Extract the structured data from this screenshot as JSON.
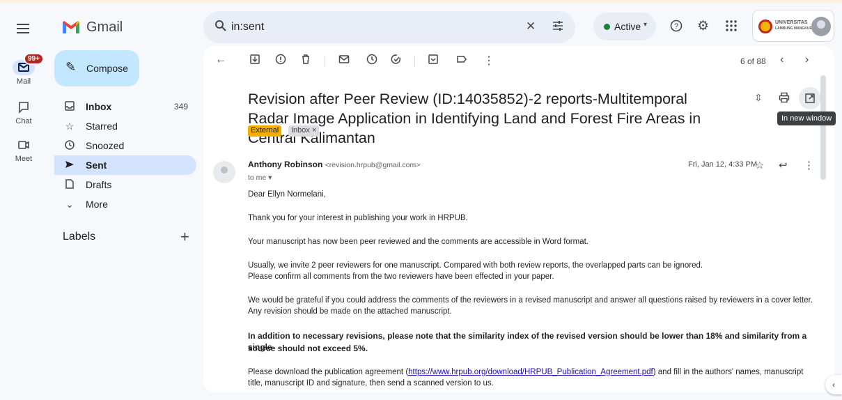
{
  "app": {
    "title": "Gmail"
  },
  "rail": {
    "mail_label": "Mail",
    "mail_badge": "99+",
    "chat_label": "Chat",
    "meet_label": "Meet"
  },
  "search": {
    "value": "in:sent"
  },
  "header": {
    "status": "Active",
    "org_name": "UNIVERSITAS",
    "org_sub": "LAMBUNG MANGKURAT"
  },
  "nav": {
    "compose": "Compose",
    "items": [
      {
        "label": "Inbox",
        "count": "349",
        "icon": "inbox-icon"
      },
      {
        "label": "Starred",
        "count": "",
        "icon": "star-icon"
      },
      {
        "label": "Snoozed",
        "count": "",
        "icon": "clock-icon"
      },
      {
        "label": "Sent",
        "count": "",
        "icon": "send-icon"
      },
      {
        "label": "Drafts",
        "count": "",
        "icon": "draft-icon"
      },
      {
        "label": "More",
        "count": "",
        "icon": "chevron-down-icon"
      }
    ],
    "labels_heading": "Labels"
  },
  "toolbar": {
    "pager": "6 of 88"
  },
  "email": {
    "subject": "Revision after Peer Review (ID:14035852)-2 reports-Multitemporal Radar Image Application in Identifying Land and Forest Fire Areas in Central Kalimantan",
    "chip_external": "External",
    "chip_inbox": "Inbox ×",
    "tooltip": "In new window",
    "sender_name": "Anthony Robinson",
    "sender_email": "<revision.hrpub@gmail.com>",
    "to": "to me ▾",
    "date": "Fri, Jan 12, 4:33 PM",
    "body": {
      "greeting": "Dear Ellyn Normelani,",
      "p1": "Thank you for your interest in publishing your work in HRPUB.",
      "p2": "Your manuscript has now been peer reviewed and the comments are accessible in Word format.",
      "p3a": "Usually, we invite 2 peer reviewers for one manuscript. Compared with both review reports, the overlapped parts can be ignored.",
      "p3b": "Please confirm all comments from the two reviewers have been effected in your paper.",
      "p4a": "We would be grateful if you could address the comments of the reviewers in a revised manuscript and answer all questions raised by reviewers in a cover letter.",
      "p4b": "Any revision should be made on the attached manuscript.",
      "p5a": "In addition to necessary revisions, please note that the similarity index of the revised version should be lower than 18% and similarity from a single",
      "p5b": "source should not exceed 5%.",
      "p6_pre": "Please download the publication agreement (",
      "p6_link": "https://www.hrpub.org/download/HRPUB_Publication_Agreement.pdf",
      "p6_post": ") and fill in the authors' names, manuscript",
      "p6b": "title, manuscript ID and signature, then send a scanned version to us."
    }
  }
}
